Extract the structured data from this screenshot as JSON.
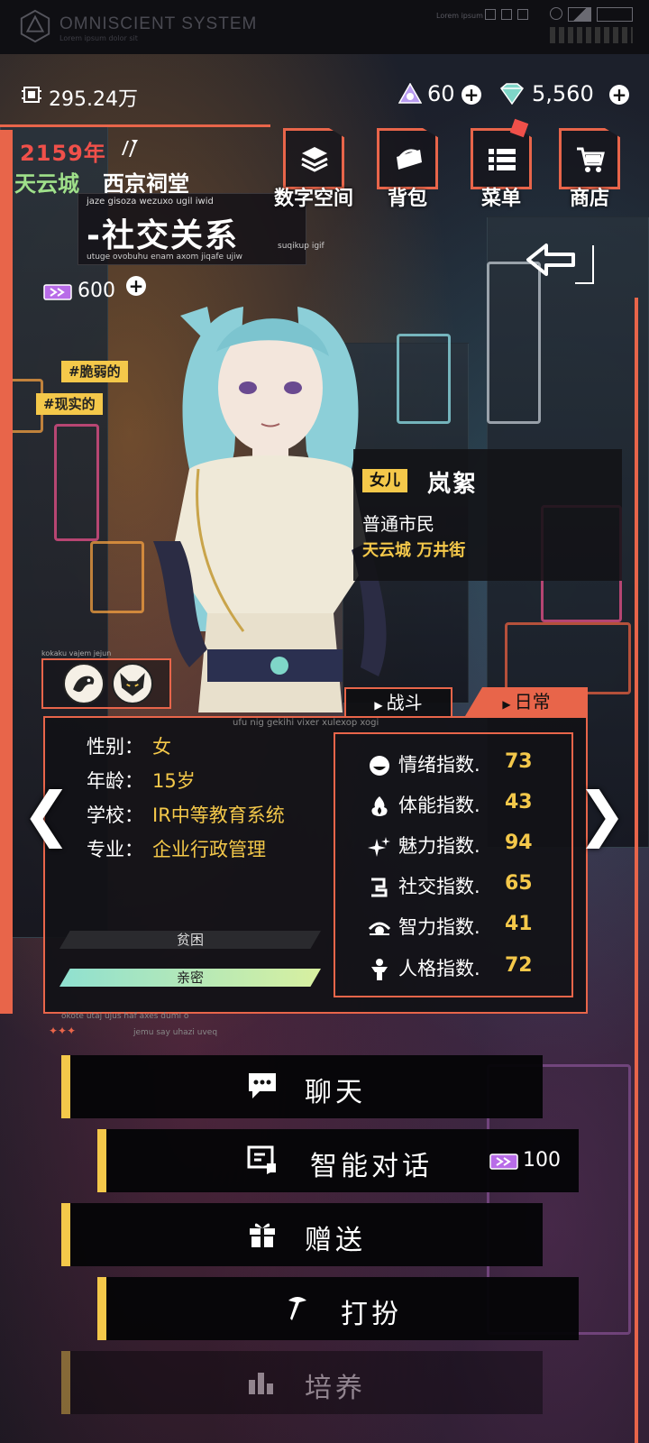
{
  "header": {
    "app_title": "OMNISCIENT SYSTEM",
    "app_subtitle": "Lorem ipsum dolor sit",
    "corner_text": "Lorem ipsum"
  },
  "currency": {
    "coins": "295.24万",
    "gems": "60",
    "diamonds": "5,560",
    "tickets": "600",
    "plus_label": "+"
  },
  "location": {
    "year": "2159年",
    "city": "天云城",
    "district": "西京祠堂"
  },
  "page": {
    "title": "-社交关系",
    "caption_top": "jaze gisoza wezuxo ugil iwid",
    "caption_bottom": "utuge ovobuhu enam axom jiqafe ujiw",
    "caption_right": "suqikup igif"
  },
  "menu": [
    {
      "label": "数字空间",
      "icon": "stack-icon"
    },
    {
      "label": "背包",
      "icon": "bag-icon"
    },
    {
      "label": "菜单",
      "icon": "list-icon"
    },
    {
      "label": "商店",
      "icon": "cart-icon"
    }
  ],
  "tags": [
    "#脆弱的",
    "#现实的"
  ],
  "character": {
    "relation": "女儿",
    "name": "岚絮",
    "occupation": "普通市民",
    "address": "天云城 万井街"
  },
  "badges": {
    "caption": "kokaku vajem jejun",
    "items": [
      "dragon-badge-icon",
      "fox-badge-icon"
    ]
  },
  "tabs": {
    "battle": "战斗",
    "daily": "日常"
  },
  "panel": {
    "caption": "ufu nig gekihi vixer xulexop xogi",
    "footer_a": "okote utaj ujus haf axes dumi o",
    "footer_b": "jemu say uhazi uveq",
    "info": [
      {
        "key": "性别：",
        "value": "女"
      },
      {
        "key": "年龄：",
        "value": "15岁"
      },
      {
        "key": "学校：",
        "value": "IR中等教育系统"
      },
      {
        "key": "专业：",
        "value": "企业行政管理"
      }
    ],
    "meters": {
      "poor": "贫困",
      "close": "亲密"
    },
    "stats": [
      {
        "label": "情绪指数.",
        "value": "73",
        "icon": "mood-icon"
      },
      {
        "label": "体能指数.",
        "value": "43",
        "icon": "flame-icon"
      },
      {
        "label": "魅力指数.",
        "value": "94",
        "icon": "sparkle-icon"
      },
      {
        "label": "社交指数.",
        "value": "65",
        "icon": "social-icon"
      },
      {
        "label": "智力指数.",
        "value": "41",
        "icon": "eye-icon"
      },
      {
        "label": "人格指数.",
        "value": "72",
        "icon": "person-icon"
      }
    ]
  },
  "actions": {
    "chat": "聊天",
    "ai_chat": "智能对话",
    "ai_chat_cost": "100",
    "gift": "赠送",
    "dress": "打扮",
    "train": "培养"
  },
  "colors": {
    "accent": "#e8654a",
    "highlight": "#f4c84a",
    "city_green": "#9fe08a",
    "year_red": "#f0504a"
  }
}
